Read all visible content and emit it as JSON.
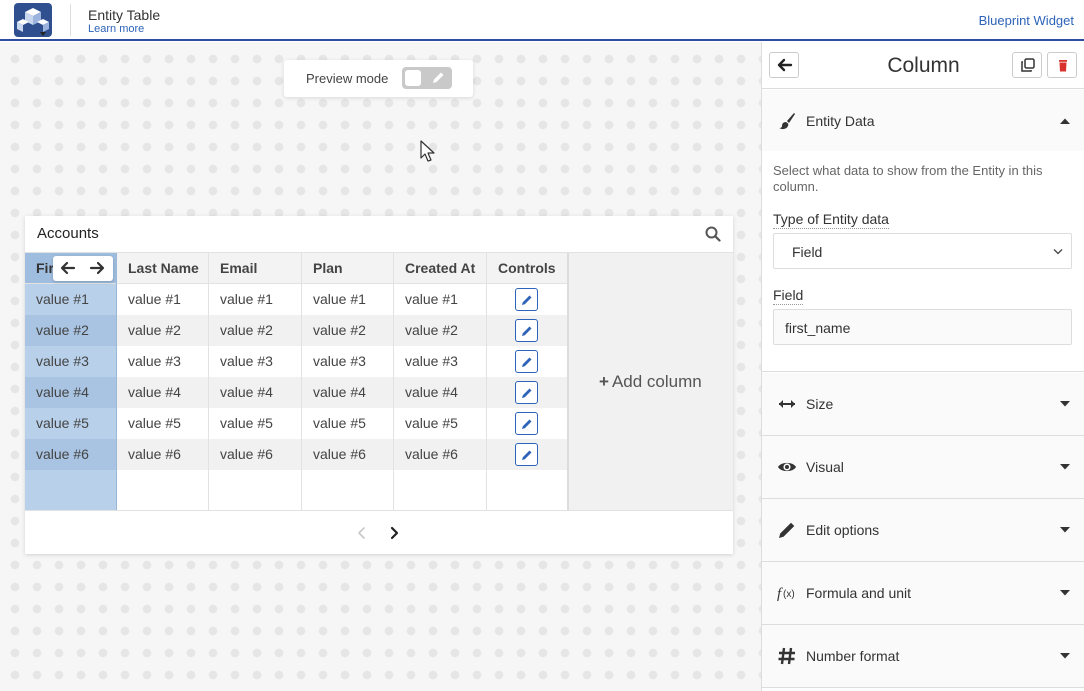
{
  "header": {
    "title": "Entity Table",
    "learn_more": "Learn more",
    "blueprint_link": "Blueprint Widget"
  },
  "canvas": {
    "preview": {
      "label": "Preview mode",
      "enabled": false
    }
  },
  "widget": {
    "title": "Accounts",
    "columns": [
      {
        "label": "Fir",
        "selected": true
      },
      {
        "label": "Last Name"
      },
      {
        "label": "Email"
      },
      {
        "label": "Plan"
      },
      {
        "label": "Created At"
      },
      {
        "label": "Controls"
      }
    ],
    "rows": [
      [
        "value #1",
        "value #1",
        "value #1",
        "value #1",
        "value #1"
      ],
      [
        "value #2",
        "value #2",
        "value #2",
        "value #2",
        "value #2"
      ],
      [
        "value #3",
        "value #3",
        "value #3",
        "value #3",
        "value #3"
      ],
      [
        "value #4",
        "value #4",
        "value #4",
        "value #4",
        "value #4"
      ],
      [
        "value #5",
        "value #5",
        "value #5",
        "value #5",
        "value #5"
      ],
      [
        "value #6",
        "value #6",
        "value #6",
        "value #6",
        "value #6"
      ]
    ],
    "add_column": "Add column"
  },
  "panel": {
    "title": "Column",
    "entity_data": {
      "label": "Entity Data",
      "description": "Select what data to show from the Entity in this column.",
      "type_label": "Type of Entity data",
      "type_value": "Field",
      "field_label": "Field",
      "field_value": "first_name"
    },
    "sections": [
      {
        "label": "Size",
        "icon": "resize-horizontal-icon"
      },
      {
        "label": "Visual",
        "icon": "eye-icon"
      },
      {
        "label": "Edit options",
        "icon": "pencil-icon"
      },
      {
        "label": "Formula and unit",
        "icon": "function-icon"
      },
      {
        "label": "Number format",
        "icon": "hash-icon"
      }
    ]
  },
  "colors": {
    "accent": "#2d63b8",
    "header_border": "#2d4e9e",
    "selected_column": "#b8d0ea",
    "delete": "#d9322c"
  }
}
